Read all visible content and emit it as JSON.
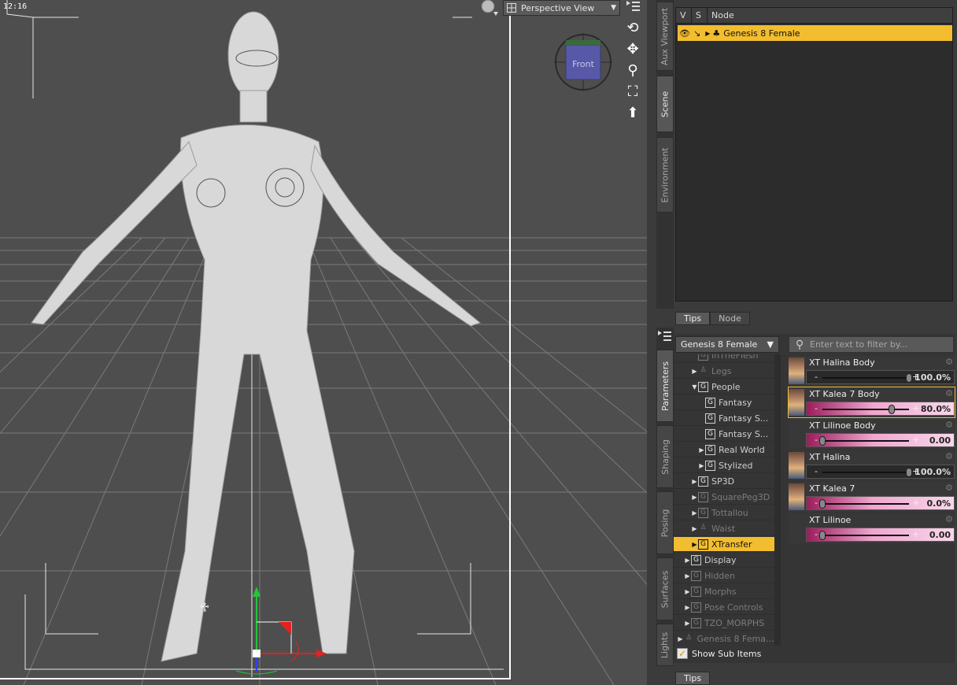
{
  "viewport": {
    "clock": "12:16",
    "view_label": "Perspective View",
    "cube_label": "Front"
  },
  "side_tabs_top": [
    "Aux Viewport",
    "Scene",
    "Environment"
  ],
  "side_tabs_bottom": [
    "Parameters",
    "Shaping",
    "Posing",
    "Surfaces",
    "Lights"
  ],
  "scene": {
    "columns": [
      "V",
      "S",
      "Node"
    ],
    "row": "Genesis 8 Female"
  },
  "mid_tabs": [
    "Tips",
    "Node"
  ],
  "params": {
    "figure_select": "Genesis 8 Female",
    "filter_placeholder": "Enter text to filter by...",
    "tree": [
      {
        "label": "InTheFlesh",
        "kind": "group",
        "indent": 2,
        "twisty": "",
        "state": "dim"
      },
      {
        "label": "Legs",
        "kind": "figure",
        "indent": 2,
        "twisty": "▶",
        "state": "dim"
      },
      {
        "label": "People",
        "kind": "group",
        "indent": 2,
        "twisty": "▼",
        "state": ""
      },
      {
        "label": "Fantasy",
        "kind": "group",
        "indent": 3,
        "twisty": "",
        "state": ""
      },
      {
        "label": "Fantasy S...",
        "kind": "group",
        "indent": 3,
        "twisty": "",
        "state": ""
      },
      {
        "label": "Fantasy S...",
        "kind": "group",
        "indent": 3,
        "twisty": "",
        "state": ""
      },
      {
        "label": "Real World",
        "kind": "group",
        "indent": 3,
        "twisty": "▶",
        "state": ""
      },
      {
        "label": "Stylized",
        "kind": "group",
        "indent": 3,
        "twisty": "▶",
        "state": ""
      },
      {
        "label": "SP3D",
        "kind": "group",
        "indent": 2,
        "twisty": "▶",
        "state": ""
      },
      {
        "label": "SquarePeg3D",
        "kind": "group",
        "indent": 2,
        "twisty": "▶",
        "state": "dim"
      },
      {
        "label": "Tottallou",
        "kind": "group",
        "indent": 2,
        "twisty": "▶",
        "state": "dim"
      },
      {
        "label": "Waist",
        "kind": "figure",
        "indent": 2,
        "twisty": "▶",
        "state": "dim"
      },
      {
        "label": "XTransfer",
        "kind": "group",
        "indent": 2,
        "twisty": "▶",
        "state": "sel"
      },
      {
        "label": "Display",
        "kind": "group",
        "indent": 1,
        "twisty": "▶",
        "state": ""
      },
      {
        "label": "Hidden",
        "kind": "group",
        "indent": 1,
        "twisty": "▶",
        "state": "dim"
      },
      {
        "label": "Morphs",
        "kind": "group",
        "indent": 1,
        "twisty": "▶",
        "state": "dim"
      },
      {
        "label": "Pose Controls",
        "kind": "group",
        "indent": 1,
        "twisty": "▶",
        "state": "dim"
      },
      {
        "label": "TZO_MORPHS",
        "kind": "group",
        "indent": 1,
        "twisty": "▶",
        "state": "dim"
      },
      {
        "label": "Genesis 8 Femal...",
        "kind": "figure",
        "indent": 0,
        "twisty": "▶",
        "state": "dim"
      }
    ],
    "show_sub_items": "Show Sub Items",
    "properties": [
      {
        "name": "XT Halina Body",
        "value": "100.0%",
        "fraction": 1.0,
        "style": "dark",
        "thumb": true,
        "highlight": false
      },
      {
        "name": "XT Kalea 7 Body",
        "value": "80.0%",
        "fraction": 0.8,
        "style": "pink",
        "thumb": true,
        "highlight": true
      },
      {
        "name": "XT Lilinoe Body",
        "value": "0.00",
        "fraction": 0.0,
        "style": "pink",
        "thumb": false,
        "highlight": false
      },
      {
        "name": "XT Halina",
        "value": "100.0%",
        "fraction": 1.0,
        "style": "dark",
        "thumb": true,
        "highlight": false
      },
      {
        "name": "XT Kalea 7",
        "value": "0.0%",
        "fraction": 0.0,
        "style": "pink",
        "thumb": true,
        "highlight": false
      },
      {
        "name": "XT Lilinoe",
        "value": "0.00",
        "fraction": 0.0,
        "style": "pink",
        "thumb": false,
        "highlight": false
      }
    ]
  },
  "bottom_tab": "Tips",
  "colors": {
    "accent": "#f2bd2e",
    "viewport_bg": "#4e4e4e",
    "panel_bg": "#3b3b3b"
  }
}
